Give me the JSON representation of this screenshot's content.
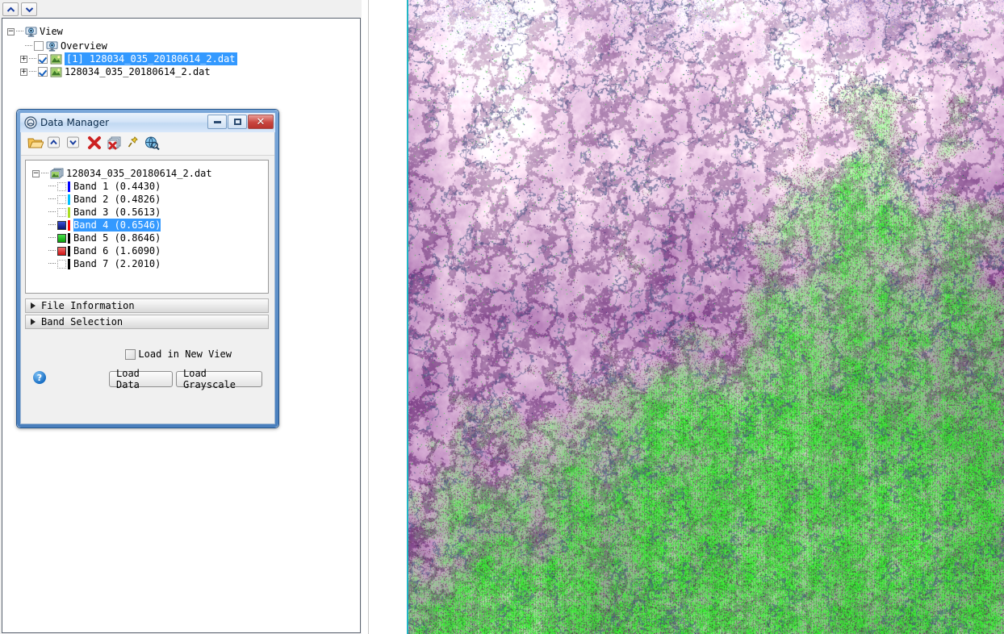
{
  "layer_panel": {
    "toolbar": [
      {
        "name": "move-layer-up-button",
        "icon": "chevron-up-icon"
      },
      {
        "name": "move-layer-down-button",
        "icon": "chevron-down-icon"
      }
    ],
    "tree": [
      {
        "label": "View",
        "icon": "view-display-icon",
        "expander": "−",
        "checkbox": "none",
        "selected": false,
        "depth": 0
      },
      {
        "label": "Overview",
        "icon": "view-display-icon",
        "expander": "none",
        "checkbox": "unchecked",
        "selected": false,
        "depth": 1
      },
      {
        "label": "[1] 128034_035_20180614_2.dat",
        "icon": "raster-image-icon",
        "expander": "+",
        "checkbox": "checked",
        "selected": true,
        "depth": 1
      },
      {
        "label": "128034_035_20180614_2.dat",
        "icon": "raster-image-icon",
        "expander": "+",
        "checkbox": "checked",
        "selected": false,
        "depth": 1
      }
    ]
  },
  "data_manager": {
    "title": "Data Manager",
    "window_buttons": {
      "minimize": "–",
      "maximize": "□",
      "close": "✕"
    },
    "toolbar": [
      {
        "name": "open-file-button",
        "icon": "open-folder-icon"
      },
      {
        "name": "move-up-button",
        "icon": "chevron-up-icon"
      },
      {
        "name": "move-down-button",
        "icon": "chevron-down-icon"
      },
      {
        "name": "close-file-button",
        "icon": "red-x-icon"
      },
      {
        "name": "close-all-files-button",
        "icon": "stack-red-x-icon"
      },
      {
        "name": "pin-button",
        "icon": "pushpin-icon"
      },
      {
        "name": "view-metadata-button",
        "icon": "globe-search-icon"
      }
    ],
    "file_node": {
      "label": "128034_035_20180614_2.dat",
      "expander": "−",
      "icon": "raster-stack-icon"
    },
    "bands": [
      {
        "label": "Band 1  (0.4430)",
        "swatch": "#0000ff",
        "check": "empty",
        "selected": false
      },
      {
        "label": "Band 2  (0.4826)",
        "swatch": "#00bfff",
        "check": "empty",
        "selected": false
      },
      {
        "label": "Band 3  (0.5613)",
        "swatch": "#aadd22",
        "check": "empty",
        "selected": false
      },
      {
        "label": "Band 4  (0.6546)",
        "swatch": "#ff0000",
        "check": "blue",
        "selected": true
      },
      {
        "label": "Band 5  (0.8646)",
        "swatch": "#000000",
        "check": "green",
        "selected": false
      },
      {
        "label": "Band 6  (1.6090)",
        "swatch": "#000000",
        "check": "red",
        "selected": false
      },
      {
        "label": "Band 7  (2.2010)",
        "swatch": "#000000",
        "check": "empty",
        "selected": false
      }
    ],
    "highlight_color": "#ff00cc",
    "accordions": [
      {
        "label": "File Information"
      },
      {
        "label": "Band Selection"
      }
    ],
    "load_in_new_view": {
      "label": "Load in New View",
      "checked": false
    },
    "buttons": {
      "load_data": "Load Data",
      "load_grayscale": "Load Grayscale",
      "help": "?"
    }
  },
  "image_view": {
    "name": "satellite-false-color-image",
    "description": "Landsat false-color composite, magenta/pink highlands in upper area transitioning to bright green vegetation in lower right",
    "edge_color": "#1fb6c4"
  }
}
